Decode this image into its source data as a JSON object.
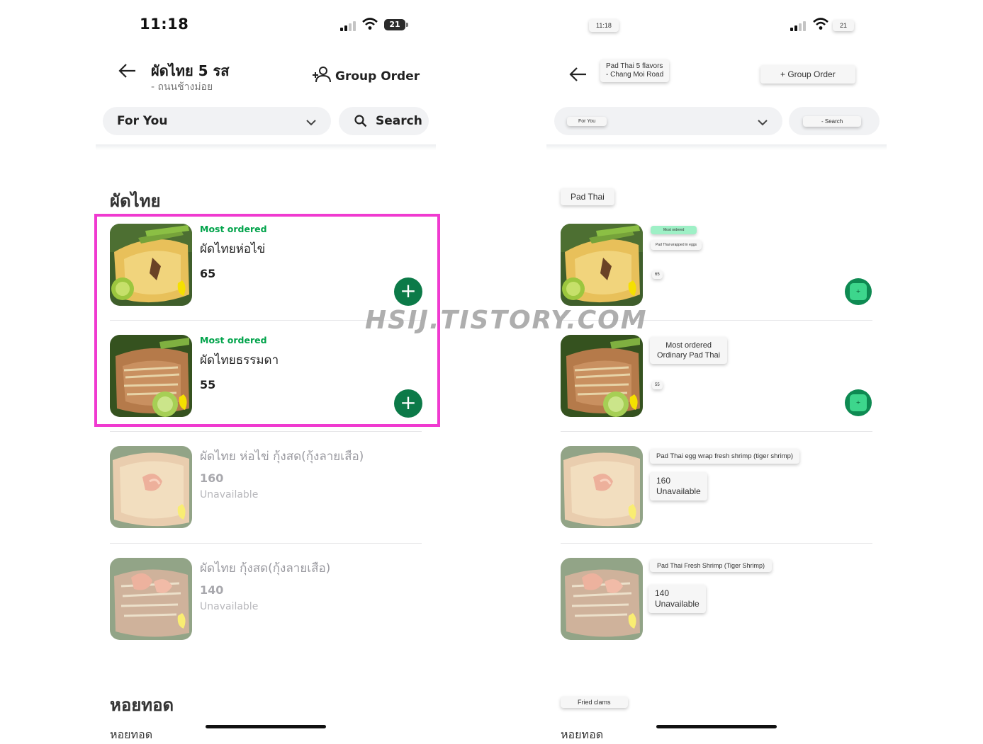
{
  "left": {
    "status_time": "11:18",
    "battery": "21",
    "header_title": "ผัดไทย 5 รส",
    "header_subtitle": "- ถนนช้างม่อย",
    "group_order": "Group Order",
    "category_select": "For You",
    "search": "Search",
    "section_title": "ผัดไทย",
    "items": [
      {
        "badge": "Most ordered",
        "name": "ผัดไทยห่อไข่",
        "price": "65"
      },
      {
        "badge": "Most ordered",
        "name": "ผัดไทยธรรมดา",
        "price": "55"
      },
      {
        "name": "ผัดไทย ห่อไข่ กุ้งสด(กุ้งลายเสือ)",
        "price": "160",
        "status": "Unavailable"
      },
      {
        "name": "ผัดไทย กุ้งสด(กุ้งลายเสือ)",
        "price": "140",
        "status": "Unavailable"
      }
    ],
    "next_section_title": "หอยทอด",
    "next_section_item": "หอยทอด"
  },
  "right": {
    "status_time": "11:18",
    "battery": "21",
    "header_title": "Pad Thai 5 flavors",
    "header_subtitle": "- Chang Moi Road",
    "group_order": "+ Group Order",
    "category_select": "For You",
    "search": "- Search",
    "section_title": "Pad Thai",
    "items": [
      {
        "badge": "Most ordered",
        "name": "Pad Thai wrapped in eggs",
        "price": "65"
      },
      {
        "badge": "Most ordered",
        "name": "Ordinary Pad Thai",
        "price": "55"
      },
      {
        "name": "Pad Thai egg wrap fresh shrimp (tiger shrimp)",
        "price": "160",
        "status": "Unavailable"
      },
      {
        "name": "Pad Thai Fresh Shrimp (Tiger Shrimp)",
        "price": "140",
        "status": "Unavailable"
      }
    ],
    "next_section_title": "Fried clams",
    "next_section_item": "หอยทอด"
  },
  "watermark": "HSIJ.TISTORY.COM",
  "colors": {
    "accent_green": "#0c7a48",
    "badge_green": "#00a34a",
    "highlight": "#f03ad0"
  },
  "icons": [
    "back-arrow-icon",
    "group-add-icon",
    "chevron-down-icon",
    "search-icon",
    "plus-icon",
    "signal-icon",
    "wifi-icon",
    "battery-icon"
  ]
}
